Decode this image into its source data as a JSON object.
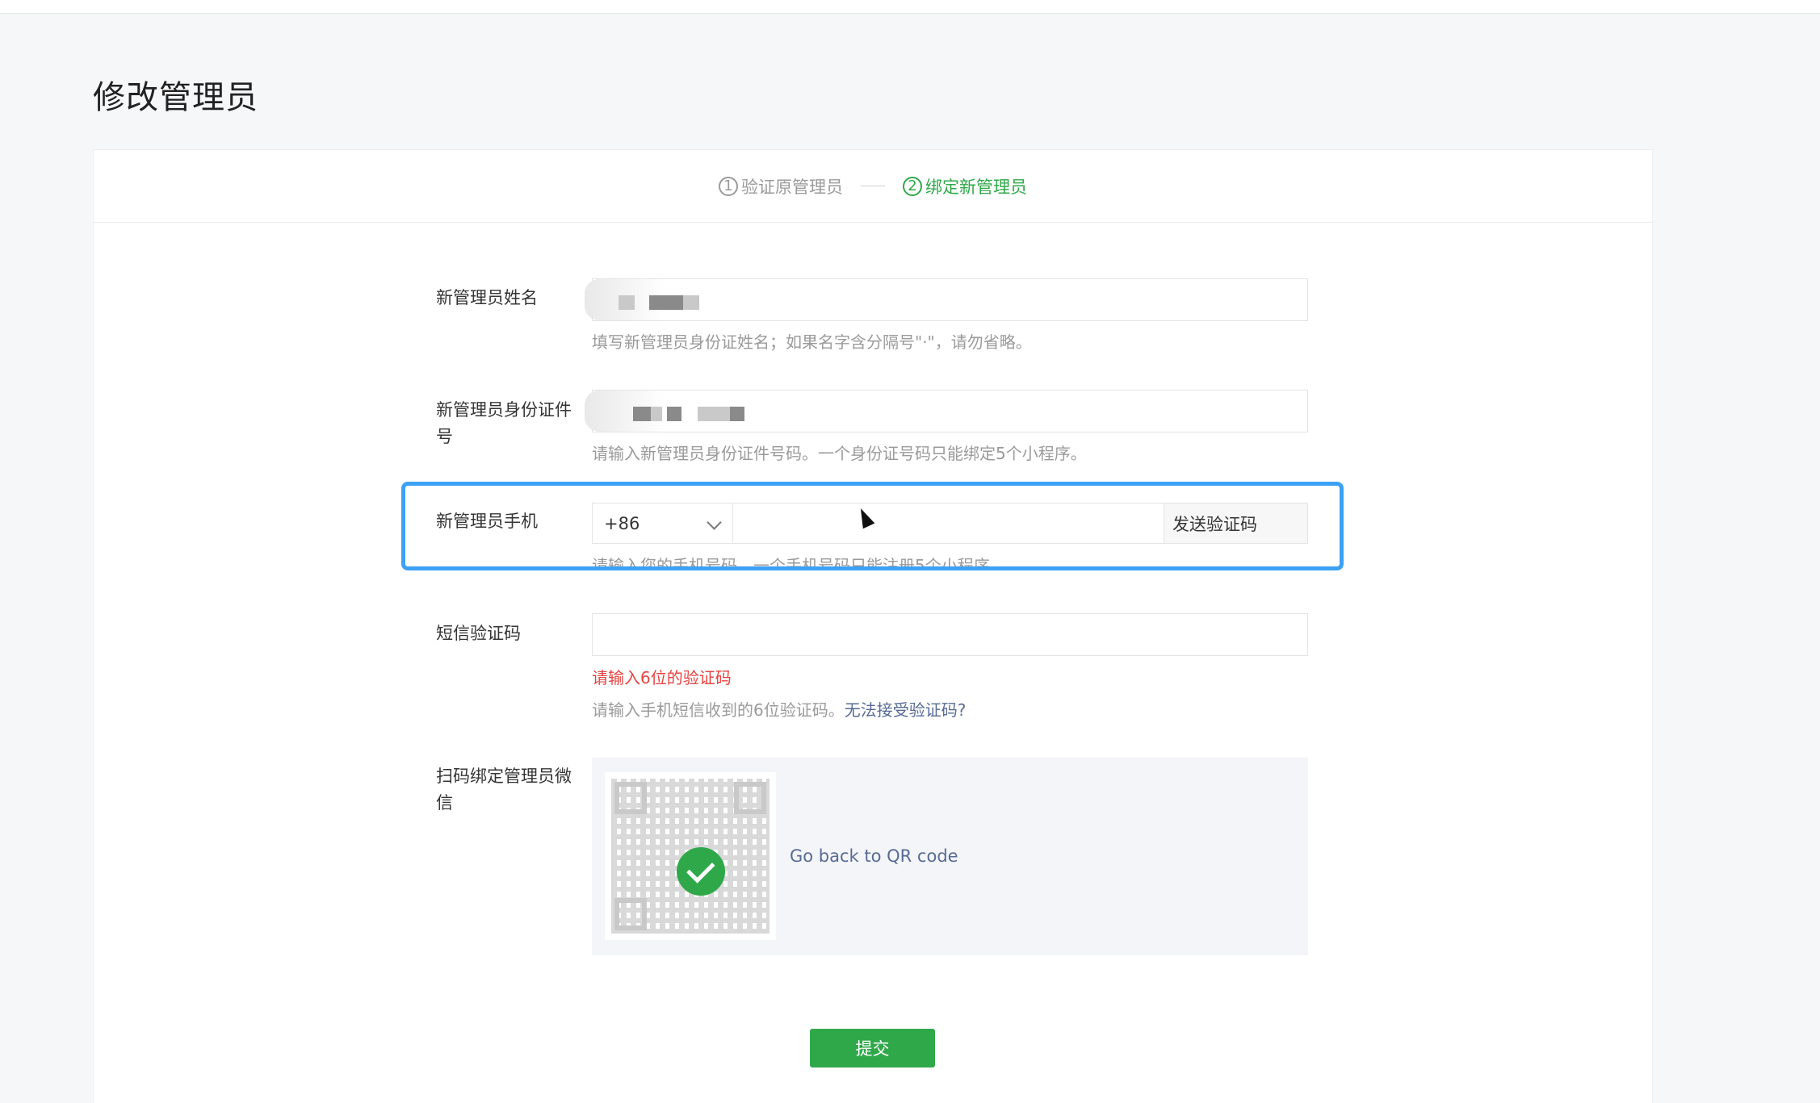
{
  "page": {
    "title": "修改管理员"
  },
  "steps": [
    {
      "num": "1",
      "label": "验证原管理员",
      "active": false
    },
    {
      "num": "2",
      "label": "绑定新管理员",
      "active": true
    }
  ],
  "form": {
    "name": {
      "label": "新管理员姓名",
      "hint": "填写新管理员身份证姓名；如果名字含分隔号\"·\"，请勿省略。"
    },
    "id_number": {
      "label": "新管理员身份证件号",
      "hint": "请输入新管理员身份证件号码。一个身份证号码只能绑定5个小程序。"
    },
    "phone": {
      "label": "新管理员手机",
      "country_code": "+86",
      "send_code_label": "发送验证码",
      "hint": "请输入您的手机号码，一个手机号码只能注册5个小程序。"
    },
    "sms_code": {
      "label": "短信验证码",
      "error": "请输入6位的验证码",
      "hint": "请输入手机短信收到的6位验证码。",
      "help_link": "无法接受验证码?"
    },
    "wechat": {
      "label": "扫码绑定管理员微信",
      "link": "Go back to QR code"
    }
  },
  "submit_label": "提交",
  "colors": {
    "accent_green": "#2fa84a",
    "highlight_blue": "#3ba1f5",
    "error_red": "#e64340",
    "link_blue": "#576b95"
  }
}
